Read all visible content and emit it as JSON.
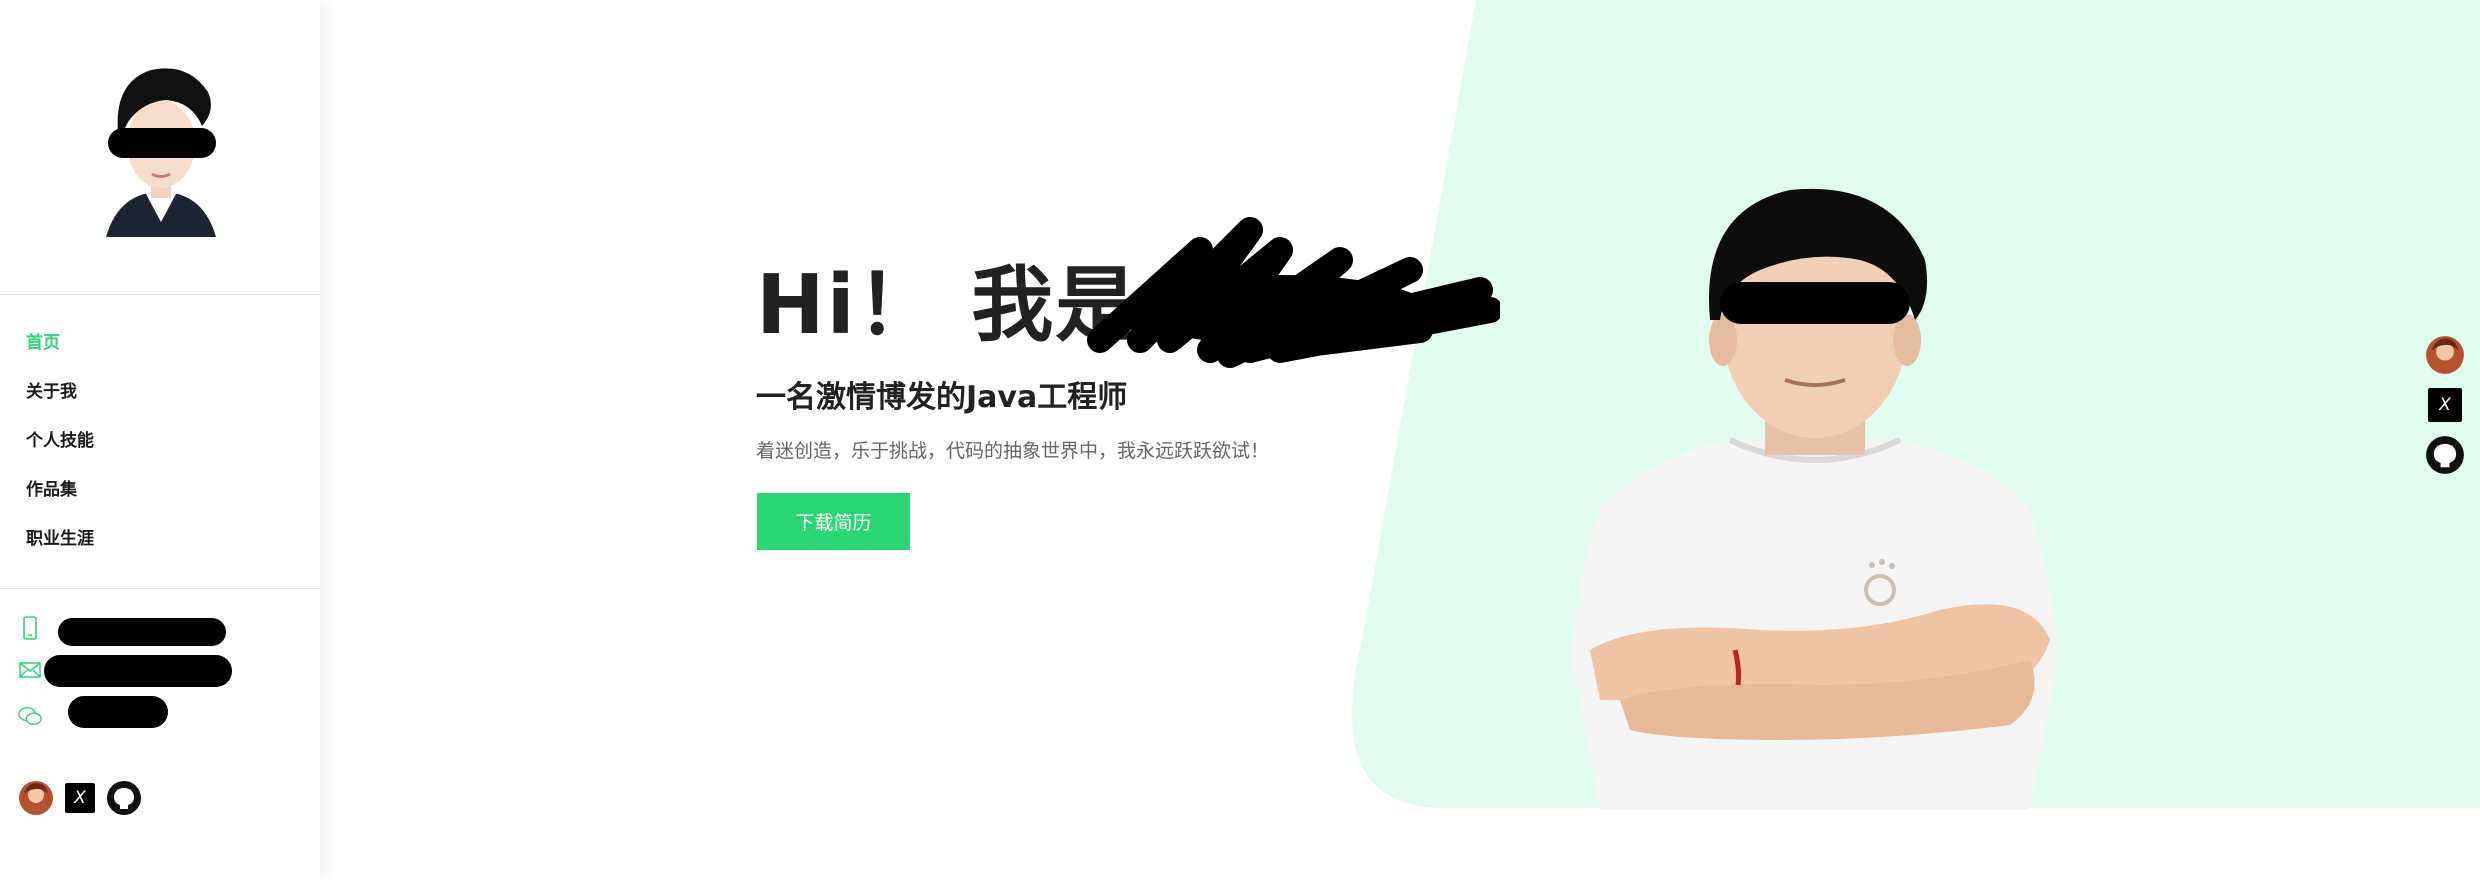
{
  "sidebar": {
    "nav_items": [
      {
        "label": "首页",
        "active": true
      },
      {
        "label": "关于我",
        "active": false
      },
      {
        "label": "个人技能",
        "active": false
      },
      {
        "label": "作品集",
        "active": false
      },
      {
        "label": "职业生涯",
        "active": false
      }
    ],
    "contacts": [
      {
        "icon": "phone-icon",
        "value": ""
      },
      {
        "icon": "mail-icon",
        "value": ""
      },
      {
        "icon": "wechat-icon",
        "value": ""
      }
    ],
    "socials": [
      {
        "icon": "avatar-social-icon"
      },
      {
        "icon": "x-icon",
        "text": "X"
      },
      {
        "icon": "github-icon"
      }
    ]
  },
  "hero": {
    "title": "Hi！ 我是",
    "subtitle": "一名激情博发的Java工程师",
    "description": "着迷创造，乐于挑战，代码的抽象世界中，我永远跃跃欲试！",
    "download_button": "下载简历"
  },
  "float_socials": [
    {
      "icon": "avatar-social-icon"
    },
    {
      "icon": "x-icon",
      "text": "X"
    },
    {
      "icon": "github-icon"
    }
  ],
  "colors": {
    "accent": "#2bd574",
    "mint_background": "#e0fcee",
    "text_dark": "#222222",
    "text_muted": "#666666"
  }
}
